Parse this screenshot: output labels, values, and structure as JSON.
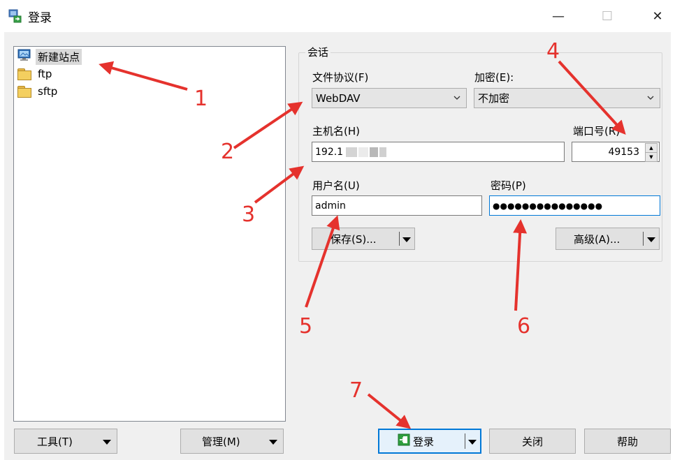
{
  "window": {
    "title": "登录",
    "minimize_glyph": "—",
    "maximize_glyph": "☐",
    "close_glyph": "✕"
  },
  "tree": {
    "items": [
      {
        "label": "新建站点",
        "icon": "monitor-icon",
        "selected": true
      },
      {
        "label": "ftp",
        "icon": "folder-icon"
      },
      {
        "label": "sftp",
        "icon": "folder-icon"
      }
    ]
  },
  "session": {
    "group_title": "会话",
    "protocol_label": "文件协议(F)",
    "protocol_value": "WebDAV",
    "encryption_label": "加密(E):",
    "encryption_value": "不加密",
    "host_label": "主机名(H)",
    "host_value": "192.1",
    "port_label": "端口号(R)",
    "port_value": "49153",
    "username_label": "用户名(U)",
    "username_value": "admin",
    "password_label": "密码(P)",
    "password_value": "●●●●●●●●●●●●●●●",
    "save_label": "保存(S)...",
    "advanced_label": "高级(A)..."
  },
  "footer": {
    "tools_label": "工具(T)",
    "manage_label": "管理(M)",
    "login_label": "登录",
    "close_label": "关闭",
    "help_label": "帮助"
  },
  "annotations": {
    "n1": "1",
    "n2": "2",
    "n3": "3",
    "n4": "4",
    "n5": "5",
    "n6": "6",
    "n7": "7"
  },
  "colors": {
    "annotation": "#e5322d",
    "focus_border": "#0078d7",
    "login_icon_green": "#2e9e3e"
  }
}
